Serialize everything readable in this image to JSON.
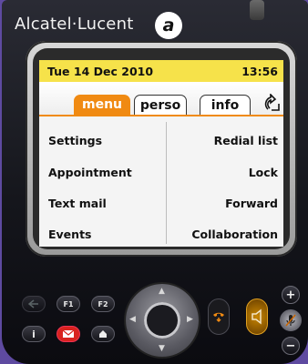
{
  "brand": {
    "name": "Alcatel·Lucent",
    "logo_icon": "alcatel-lucent-logo-icon"
  },
  "status": {
    "date": "Tue 14 Dec 2010",
    "time": "13:56"
  },
  "tabs": [
    {
      "label": "menu",
      "active": true
    },
    {
      "label": "perso",
      "active": false
    },
    {
      "label": "info",
      "active": false
    }
  ],
  "tab_extra_icon": "rotate-arrow-icon",
  "menu": {
    "left": [
      "Settings",
      "Appointment",
      "Text mail",
      "Events"
    ],
    "right": [
      "Redial list",
      "Lock",
      "Forward",
      "Collaboration"
    ]
  },
  "keys": {
    "f1": "F1",
    "f2": "F2",
    "info": "i",
    "plus": "+",
    "minus": "−"
  },
  "colors": {
    "status_bar": "#f6e24a",
    "accent_orange": "#f08a12",
    "screen_bg": "#f4f4f4",
    "phone_body": "#15161c",
    "background": "#5e4aa0"
  }
}
